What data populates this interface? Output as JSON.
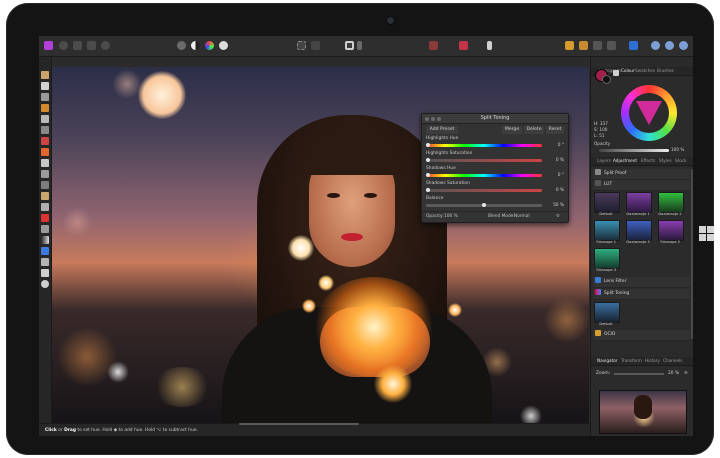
{
  "split_toning": {
    "title": "Split Toning",
    "buttons": {
      "add_preset": "Add Preset",
      "merge": "Merge",
      "delete": "Delete",
      "reset": "Reset"
    },
    "highlights_hue_label": "Highlights Hue",
    "highlights_hue_value": "0 °",
    "highlights_saturation_label": "Highlights Saturation",
    "highlights_saturation_value": "0 %",
    "shadows_hue_label": "Shadows Hue",
    "shadows_hue_value": "0 °",
    "shadows_saturation_label": "Shadows Saturation",
    "shadows_saturation_value": "0 %",
    "balance_label": "Balance",
    "balance_value": "50 %",
    "balance_level": 0.5,
    "opacity_label": "Opacity:",
    "opacity_value": "100 %",
    "blend_mode_label": "Blend Mode:",
    "blend_mode_value": "Normal"
  },
  "colour_panel": {
    "tabs": [
      "Histogram",
      "Colour",
      "Swatches",
      "Brushes"
    ],
    "active_tab": "Colour",
    "h": "H: 337",
    "s": "S: 100",
    "l": "L: 51",
    "opacity_label": "Opacity",
    "opacity_value": "100 %",
    "primary_color": "#a0204a"
  },
  "adjustment_panel": {
    "tabs": [
      "Layers",
      "Adjustment",
      "Effects",
      "Styles",
      "Stock"
    ],
    "active_tab": "Adjustment",
    "items": [
      "Split Proof",
      "LUT",
      "Lens Filter",
      "Split Toning",
      "OCIO"
    ],
    "presets": [
      "Default",
      "Daxtaranje 1",
      "Daxtaranje 2",
      "Tritanope 1",
      "Daxtaranje 3",
      "Tritanope 2",
      "Tritanope 3",
      "Default"
    ]
  },
  "navigator_panel": {
    "tabs": [
      "Navigator",
      "Transform",
      "History",
      "Channels"
    ],
    "active_tab": "Navigator",
    "zoom_label": "Zoom:",
    "zoom_value": "20 %"
  },
  "status_bar": {
    "action1": "Click",
    "or_text": " or ",
    "action2": "Drag",
    "rest": " to set hue. Hold ◆ to add hue. Hold ⌥ to subtract hue."
  },
  "colors": {
    "app_background": "#2b2b2b",
    "accent_blue": "#5fa3ff"
  }
}
